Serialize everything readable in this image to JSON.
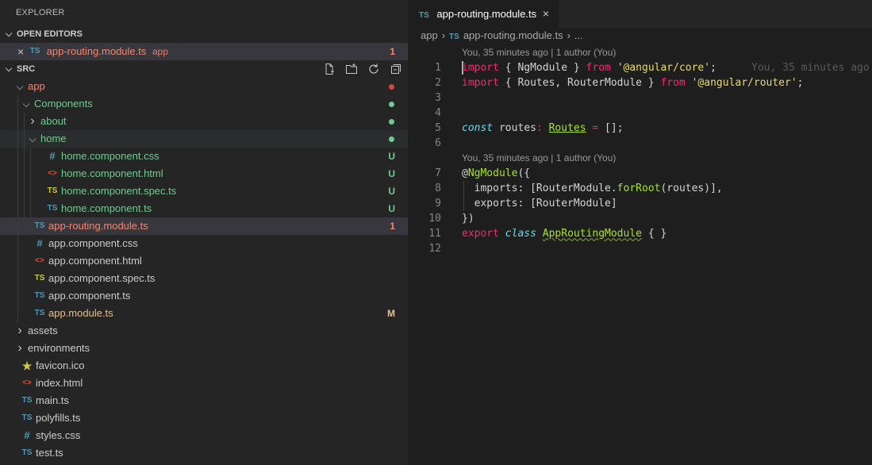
{
  "explorer": {
    "title": "EXPLORER",
    "open_editors": {
      "header": "OPEN EDITORS",
      "items": [
        {
          "icon": "TS",
          "name": "app-routing.module.ts",
          "folder": "app",
          "badge": "1"
        }
      ]
    },
    "src": {
      "header": "SRC",
      "toolbar": [
        "new-file-icon",
        "new-folder-icon",
        "refresh-icon",
        "collapse-all-icon"
      ]
    },
    "tree": [
      {
        "name": "app",
        "type": "folder-open",
        "depth": 0,
        "color": "red",
        "dot": "#c74e39"
      },
      {
        "name": "Components",
        "type": "folder-open",
        "depth": 1,
        "color": "green",
        "dot": "#73c991"
      },
      {
        "name": "about",
        "type": "folder-closed",
        "depth": 2,
        "color": "green",
        "dot": "#73c991"
      },
      {
        "name": "home",
        "type": "folder-open",
        "depth": 2,
        "color": "green",
        "dot": "#73c991",
        "hover": true
      },
      {
        "name": "home.component.css",
        "type": "file",
        "icon": "#",
        "icon_class": "c-css",
        "depth": 3,
        "color": "green",
        "badge": "U"
      },
      {
        "name": "home.component.html",
        "type": "file",
        "icon": "<>",
        "icon_class": "c-html",
        "depth": 3,
        "color": "green",
        "badge": "U"
      },
      {
        "name": "home.component.spec.ts",
        "type": "file",
        "icon": "TS",
        "icon_class": "c-spec",
        "depth": 3,
        "color": "green",
        "badge": "U"
      },
      {
        "name": "home.component.ts",
        "type": "file",
        "icon": "TS",
        "icon_class": "c-ts",
        "depth": 3,
        "color": "green",
        "badge": "U"
      },
      {
        "name": "app-routing.module.ts",
        "type": "file",
        "icon": "TS",
        "icon_class": "c-ts",
        "depth": 1,
        "color": "red",
        "badge": "1",
        "selected": true
      },
      {
        "name": "app.component.css",
        "type": "file",
        "icon": "#",
        "icon_class": "c-css",
        "depth": 1,
        "color": "white"
      },
      {
        "name": "app.component.html",
        "type": "file",
        "icon": "<>",
        "icon_class": "c-html",
        "depth": 1,
        "color": "white"
      },
      {
        "name": "app.component.spec.ts",
        "type": "file",
        "icon": "TS",
        "icon_class": "c-spec",
        "depth": 1,
        "color": "white"
      },
      {
        "name": "app.component.ts",
        "type": "file",
        "icon": "TS",
        "icon_class": "c-ts",
        "depth": 1,
        "color": "white"
      },
      {
        "name": "app.module.ts",
        "type": "file",
        "icon": "TS",
        "icon_class": "c-ts",
        "depth": 1,
        "color": "mod",
        "badge": "M"
      },
      {
        "name": "assets",
        "type": "folder-closed",
        "depth": 0,
        "color": "white"
      },
      {
        "name": "environments",
        "type": "folder-closed",
        "depth": 0,
        "color": "white"
      },
      {
        "name": "favicon.ico",
        "type": "file",
        "icon": "★",
        "icon_class": "c-spec",
        "depth": -1,
        "color": "white"
      },
      {
        "name": "index.html",
        "type": "file",
        "icon": "<>",
        "icon_class": "c-html",
        "depth": -1,
        "color": "white"
      },
      {
        "name": "main.ts",
        "type": "file",
        "icon": "TS",
        "icon_class": "c-ts",
        "depth": -1,
        "color": "white"
      },
      {
        "name": "polyfills.ts",
        "type": "file",
        "icon": "TS",
        "icon_class": "c-ts",
        "depth": -1,
        "color": "white"
      },
      {
        "name": "styles.css",
        "type": "file",
        "icon": "#",
        "icon_class": "c-css",
        "depth": -1,
        "color": "white"
      },
      {
        "name": "test.ts",
        "type": "file",
        "icon": "TS",
        "icon_class": "c-ts",
        "depth": -1,
        "color": "white"
      }
    ]
  },
  "editor": {
    "tab": {
      "icon": "TS",
      "label": "app-routing.module.ts",
      "close": "×"
    },
    "breadcrumb": {
      "folder": "app",
      "icon": "TS",
      "file": "app-routing.module.ts",
      "ellipsis": "..."
    },
    "codelens": [
      "You, 35 minutes ago | 1 author (You)",
      "You, 35 minutes ago | 1 author (You)"
    ],
    "inline_blame": "You, 35 minutes ago",
    "lines": [
      {
        "n": "1",
        "tokens": [
          [
            "k",
            "import"
          ],
          [
            "p",
            " { NgModule } "
          ],
          [
            "k",
            "from"
          ],
          [
            "p",
            " "
          ],
          [
            "s",
            "'@angular/core'"
          ],
          [
            "p",
            ";"
          ]
        ]
      },
      {
        "n": "2",
        "tokens": [
          [
            "k",
            "import"
          ],
          [
            "p",
            " { Routes, RouterModule } "
          ],
          [
            "k",
            "from"
          ],
          [
            "p",
            " "
          ],
          [
            "s",
            "'@angular/router'"
          ],
          [
            "p",
            ";"
          ]
        ]
      },
      {
        "n": "3",
        "tokens": []
      },
      {
        "n": "4",
        "tokens": []
      },
      {
        "n": "5",
        "tokens": [
          [
            "kw",
            "const"
          ],
          [
            "p",
            " routes"
          ],
          [
            "k",
            ":"
          ],
          [
            "p",
            " "
          ],
          [
            "t ul",
            "Routes"
          ],
          [
            "p",
            " "
          ],
          [
            "k",
            "="
          ],
          [
            "p",
            " [];"
          ]
        ]
      },
      {
        "n": "6",
        "tokens": []
      },
      {
        "n": "7",
        "tokens": [
          [
            "p",
            "@"
          ],
          [
            "f",
            "NgModule"
          ],
          [
            "p",
            "({"
          ]
        ]
      },
      {
        "n": "8",
        "tokens": [
          [
            "p",
            "  imports: [RouterModule."
          ],
          [
            "f",
            "forRoot"
          ],
          [
            "p",
            "(routes)],"
          ]
        ]
      },
      {
        "n": "9",
        "tokens": [
          [
            "p",
            "  exports: [RouterModule]"
          ]
        ]
      },
      {
        "n": "10",
        "tokens": [
          [
            "p",
            "})"
          ]
        ]
      },
      {
        "n": "11",
        "tokens": [
          [
            "k",
            "export"
          ],
          [
            "p",
            " "
          ],
          [
            "kw",
            "class"
          ],
          [
            "p",
            " "
          ],
          [
            "t ul2",
            "AppRoutingModule"
          ],
          [
            "p",
            " { }"
          ]
        ]
      },
      {
        "n": "12",
        "tokens": []
      }
    ]
  }
}
